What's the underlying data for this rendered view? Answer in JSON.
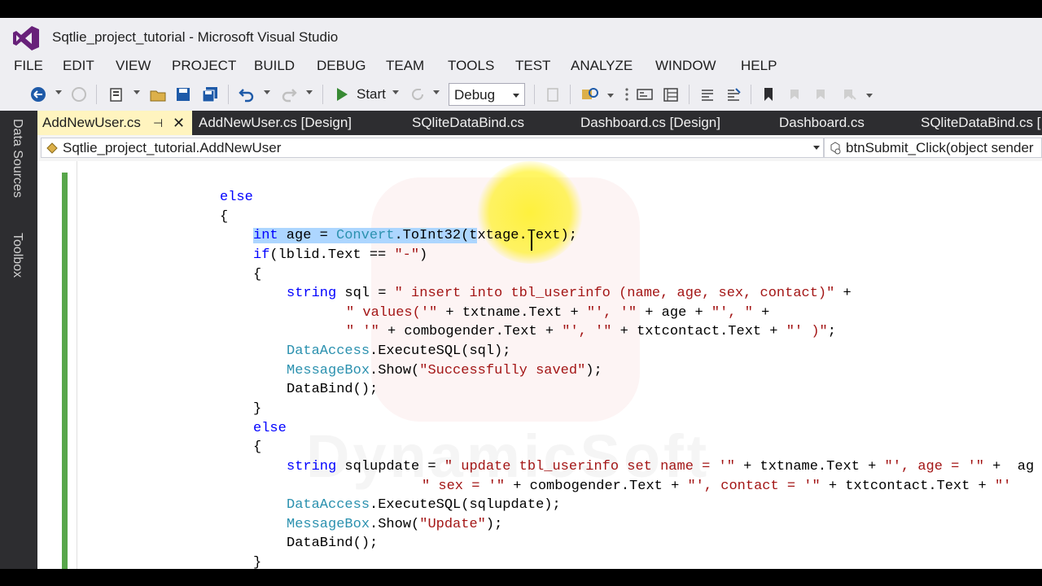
{
  "window": {
    "title": "Sqtlie_project_tutorial - Microsoft Visual Studio"
  },
  "menu": [
    "FILE",
    "EDIT",
    "VIEW",
    "PROJECT",
    "BUILD",
    "DEBUG",
    "TEAM",
    "TOOLS",
    "TEST",
    "ANALYZE",
    "WINDOW",
    "HELP"
  ],
  "toolbar": {
    "start_label": "Start",
    "config_value": "Debug",
    "icons": [
      "back-icon",
      "forward-icon",
      "new-project-icon",
      "open-file-icon",
      "save-icon",
      "save-all-icon",
      "undo-icon",
      "redo-icon",
      "start-icon",
      "refresh-icon",
      "find-icon",
      "comment-icon",
      "bookmark-icon"
    ]
  },
  "side_panel": {
    "tabs": [
      "Data Sources",
      "Toolbox"
    ]
  },
  "tabs": [
    {
      "label": "AddNewUser.cs",
      "active": true
    },
    {
      "label": "AddNewUser.cs [Design]",
      "active": false
    },
    {
      "label": "SQliteDataBind.cs",
      "active": false
    },
    {
      "label": "Dashboard.cs [Design]",
      "active": false
    },
    {
      "label": "Dashboard.cs",
      "active": false
    },
    {
      "label": "SQliteDataBind.cs [",
      "active": false
    }
  ],
  "navbar": {
    "class_path": "Sqtlie_project_tutorial.AddNewUser",
    "member": "btnSubmit_Click(object sender"
  },
  "colors": {
    "keyword": "#0000ff",
    "type": "#2b91af",
    "string": "#a31515",
    "selection": "#add6ff",
    "change_bar": "#57a64a",
    "active_tab": "#fff4bf"
  },
  "code": {
    "l1": "else",
    "l2": "{",
    "l3_kw": "int",
    "l3_a": " age = ",
    "l3_ty": "Convert",
    "l3_b": ".ToInt32(t",
    "l3_c": "xtage.Text);",
    "l4_kw": "if",
    "l4_a": "(lblid.Text == ",
    "l4_str": "\"-\"",
    "l4_b": ")",
    "l5": "{",
    "l6_kw": "string",
    "l6_a": " sql = ",
    "l6_str": "\" insert into tbl_userinfo (name, age, sex, contact)\"",
    "l6_b": " +",
    "l7_str": "\" values('\"",
    "l7_a": " + txtname.Text + ",
    "l7_str2": "\"', '\"",
    "l7_b": " + age + ",
    "l7_str3": "\"', \"",
    "l7_c": " +",
    "l8_str": "\" '\"",
    "l8_a": " + combogender.Text + ",
    "l8_str2": "\"', '\"",
    "l8_b": " + txtcontact.Text + ",
    "l8_str3": "\"' )\"",
    "l8_c": ";",
    "l9_ty": "DataAccess",
    "l9_a": ".ExecuteSQL(sql);",
    "l10_ty": "MessageBox",
    "l10_a": ".Show(",
    "l10_str": "\"Successfully saved\"",
    "l10_b": ");",
    "l11": "DataBind();",
    "l12": "}",
    "l13": "else",
    "l14": "{",
    "l15_kw": "string",
    "l15_a": " sqlupdate = ",
    "l15_str": "\" update tbl_userinfo set name = '\"",
    "l15_b": " + txtname.Text + ",
    "l15_str2": "\"', age = '\"",
    "l15_c": " +  ag",
    "l16_str": "\" sex = '\"",
    "l16_a": " + combogender.Text + ",
    "l16_str2": "\"', contact = '\"",
    "l16_b": " + txtcontact.Text + ",
    "l16_str3": "\"'",
    "l17_ty": "DataAccess",
    "l17_a": ".ExecuteSQL(sqlupdate);",
    "l18_ty": "MessageBox",
    "l18_a": ".Show(",
    "l18_str": "\"Update\"",
    "l18_b": ");",
    "l19": "DataBind();",
    "l20": "}"
  }
}
